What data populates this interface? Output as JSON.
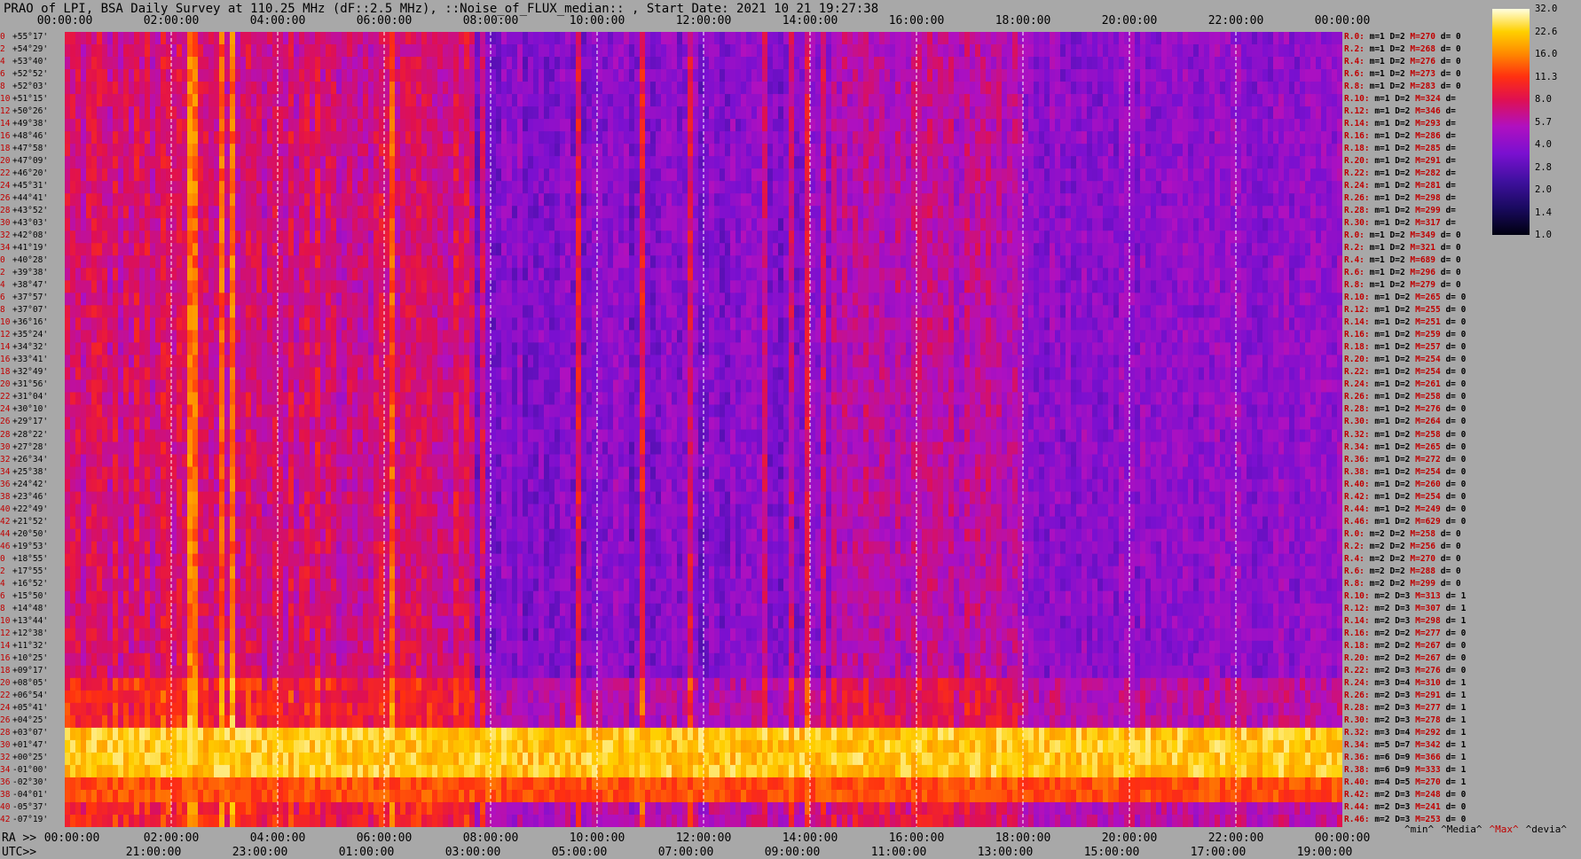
{
  "title": "PRAO of LPI, BSA Daily Survey at 110.25 MHz (dF::2.5 MHz), ::Noise_of_FLUX_median:: , Start Date: 2021 10 21 19:27:38",
  "top_times": [
    "00:00:00",
    "02:00:00",
    "04:00:00",
    "06:00:00",
    "08:00:00",
    "10:00:00",
    "12:00:00",
    "14:00:00",
    "16:00:00",
    "18:00:00",
    "20:00:00",
    "22:00:00",
    "00:00:00"
  ],
  "ra_prefix": "RA >>",
  "ra_times": [
    "00:00:00",
    "02:00:00",
    "04:00:00",
    "06:00:00",
    "08:00:00",
    "10:00:00",
    "12:00:00",
    "14:00:00",
    "16:00:00",
    "18:00:00",
    "20:00:00",
    "22:00:00",
    "00:00:00"
  ],
  "utc_prefix": "UTC>>",
  "utc_times": [
    "21:00:00",
    "23:00:00",
    "01:00:00",
    "03:00:00",
    "05:00:00",
    "07:00:00",
    "09:00:00",
    "11:00:00",
    "13:00:00",
    "15:00:00",
    "17:00:00",
    "19:00:00"
  ],
  "colorbar": {
    "ticks": [
      "32.0",
      "22.6",
      "16.0",
      "11.3",
      "8.0",
      "5.7",
      "4.0",
      "2.8",
      "2.0",
      "1.4",
      "1.0"
    ]
  },
  "footer": {
    "min": "^min^",
    "median": "^Media^",
    "max": "^Max^",
    "devia": "^devia^"
  },
  "colors": {
    "background": "#a8a8a8",
    "label_red": "#c00000"
  },
  "chart_data": {
    "type": "heatmap",
    "title": "PRAO of LPI, BSA Daily Survey at 110.25 MHz (dF::2.5 MHz), ::Noise_of_FLUX_median:: , Start Date: 2021 10 21 19:27:38",
    "x_axis": "sidereal time RA 00:00:00 to 24:00:00, grid every 2h",
    "color_scale": "log, 1.0 to 32.0",
    "declinations": [
      "+55°17'",
      "+54°29'",
      "+53°40'",
      "+52°52'",
      "+52°03'",
      "+51°15'",
      "+50°26'",
      "+49°38'",
      "+48°46'",
      "+47°58'",
      "+47°09'",
      "+46°20'",
      "+45°31'",
      "+44°41'",
      "+43°52'",
      "+43°03'",
      "+42°08'",
      "+41°19'",
      "+40°28'",
      "+39°38'",
      "+38°47'",
      "+37°57'",
      "+37°07'",
      "+36°16'",
      "+35°24'",
      "+34°32'",
      "+33°41'",
      "+32°49'",
      "+31°56'",
      "+31°04'",
      "+30°10'",
      "+29°17'",
      "+28°22'",
      "+27°28'",
      "+26°34'",
      "+25°38'",
      "+24°42'",
      "+23°46'",
      "+22°49'",
      "+21°52'",
      "+20°50'",
      "+19°53'",
      "+18°55'",
      "+17°55'",
      "+16°52'",
      "+15°50'",
      "+14°48'",
      "+13°44'",
      "+12°38'",
      "+11°32'",
      "+10°25'",
      "+09°17'",
      "+08°05'",
      "+06°54'",
      "+05°41'",
      "+04°25'",
      "+03°07'",
      "+01°47'",
      "+00°25'",
      "-01°00'",
      "-02°30'",
      "-04°01'",
      "-05°37'",
      "-07°19'"
    ],
    "row_index_labels": [
      "0",
      "2",
      "4",
      "6",
      "8",
      "10",
      "12",
      "14",
      "16",
      "18",
      "20",
      "22",
      "24",
      "26",
      "28",
      "30",
      "32",
      "34",
      "0",
      "2",
      "4",
      "6",
      "8",
      "10",
      "12",
      "14",
      "16",
      "18",
      "20",
      "22",
      "24",
      "26",
      "28",
      "30",
      "32",
      "34",
      "36",
      "38",
      "40",
      "42",
      "44",
      "46",
      "0",
      "2",
      "4",
      "6",
      "8",
      "10",
      "12",
      "14",
      "16",
      "18",
      "20",
      "22",
      "24",
      "26",
      "28",
      "30",
      "32",
      "34",
      "36",
      "38",
      "40",
      "42"
    ],
    "receivers": [
      {
        "r": "R.0:",
        "m": "m=1",
        "D": "D=2",
        "M": "M=270",
        "d": "d= 0"
      },
      {
        "r": "R.2:",
        "m": "m=1",
        "D": "D=2",
        "M": "M=268",
        "d": "d= 0"
      },
      {
        "r": "R.4:",
        "m": "m=1",
        "D": "D=2",
        "M": "M=276",
        "d": "d= 0"
      },
      {
        "r": "R.6:",
        "m": "m=1",
        "D": "D=2",
        "M": "M=273",
        "d": "d= 0"
      },
      {
        "r": "R.8:",
        "m": "m=1",
        "D": "D=2",
        "M": "M=283",
        "d": "d= 0"
      },
      {
        "r": "R.10:",
        "m": "m=1",
        "D": "D=2",
        "M": "M=324",
        "d": "d="
      },
      {
        "r": "R.12:",
        "m": "m=1",
        "D": "D=2",
        "M": "M=346",
        "d": "d="
      },
      {
        "r": "R.14:",
        "m": "m=1",
        "D": "D=2",
        "M": "M=293",
        "d": "d="
      },
      {
        "r": "R.16:",
        "m": "m=1",
        "D": "D=2",
        "M": "M=286",
        "d": "d="
      },
      {
        "r": "R.18:",
        "m": "m=1",
        "D": "D=2",
        "M": "M=285",
        "d": "d="
      },
      {
        "r": "R.20:",
        "m": "m=1",
        "D": "D=2",
        "M": "M=291",
        "d": "d="
      },
      {
        "r": "R.22:",
        "m": "m=1",
        "D": "D=2",
        "M": "M=282",
        "d": "d="
      },
      {
        "r": "R.24:",
        "m": "m=1",
        "D": "D=2",
        "M": "M=281",
        "d": "d="
      },
      {
        "r": "R.26:",
        "m": "m=1",
        "D": "D=2",
        "M": "M=298",
        "d": "d="
      },
      {
        "r": "R.28:",
        "m": "m=1",
        "D": "D=2",
        "M": "M=299",
        "d": "d="
      },
      {
        "r": "R.30:",
        "m": "m=1",
        "D": "D=2",
        "M": "M=317",
        "d": "d="
      },
      {
        "r": "R.0:",
        "m": "m=1",
        "D": "D=2",
        "M": "M=349",
        "d": "d= 0"
      },
      {
        "r": "R.2:",
        "m": "m=1",
        "D": "D=2",
        "M": "M=321",
        "d": "d= 0"
      },
      {
        "r": "R.4:",
        "m": "m=1",
        "D": "D=2",
        "M": "M=689",
        "d": "d= 0"
      },
      {
        "r": "R.6:",
        "m": "m=1",
        "D": "D=2",
        "M": "M=296",
        "d": "d= 0"
      },
      {
        "r": "R.8:",
        "m": "m=1",
        "D": "D=2",
        "M": "M=279",
        "d": "d= 0"
      },
      {
        "r": "R.10:",
        "m": "m=1",
        "D": "D=2",
        "M": "M=265",
        "d": "d= 0"
      },
      {
        "r": "R.12:",
        "m": "m=1",
        "D": "D=2",
        "M": "M=255",
        "d": "d= 0"
      },
      {
        "r": "R.14:",
        "m": "m=1",
        "D": "D=2",
        "M": "M=251",
        "d": "d= 0"
      },
      {
        "r": "R.16:",
        "m": "m=1",
        "D": "D=2",
        "M": "M=259",
        "d": "d= 0"
      },
      {
        "r": "R.18:",
        "m": "m=1",
        "D": "D=2",
        "M": "M=257",
        "d": "d= 0"
      },
      {
        "r": "R.20:",
        "m": "m=1",
        "D": "D=2",
        "M": "M=254",
        "d": "d= 0"
      },
      {
        "r": "R.22:",
        "m": "m=1",
        "D": "D=2",
        "M": "M=254",
        "d": "d= 0"
      },
      {
        "r": "R.24:",
        "m": "m=1",
        "D": "D=2",
        "M": "M=261",
        "d": "d= 0"
      },
      {
        "r": "R.26:",
        "m": "m=1",
        "D": "D=2",
        "M": "M=258",
        "d": "d= 0"
      },
      {
        "r": "R.28:",
        "m": "m=1",
        "D": "D=2",
        "M": "M=276",
        "d": "d= 0"
      },
      {
        "r": "R.30:",
        "m": "m=1",
        "D": "D=2",
        "M": "M=264",
        "d": "d= 0"
      },
      {
        "r": "R.32:",
        "m": "m=1",
        "D": "D=2",
        "M": "M=258",
        "d": "d= 0"
      },
      {
        "r": "R.34:",
        "m": "m=1",
        "D": "D=2",
        "M": "M=265",
        "d": "d= 0"
      },
      {
        "r": "R.36:",
        "m": "m=1",
        "D": "D=2",
        "M": "M=272",
        "d": "d= 0"
      },
      {
        "r": "R.38:",
        "m": "m=1",
        "D": "D=2",
        "M": "M=254",
        "d": "d= 0"
      },
      {
        "r": "R.40:",
        "m": "m=1",
        "D": "D=2",
        "M": "M=260",
        "d": "d= 0"
      },
      {
        "r": "R.42:",
        "m": "m=1",
        "D": "D=2",
        "M": "M=254",
        "d": "d= 0"
      },
      {
        "r": "R.44:",
        "m": "m=1",
        "D": "D=2",
        "M": "M=249",
        "d": "d= 0"
      },
      {
        "r": "R.46:",
        "m": "m=1",
        "D": "D=2",
        "M": "M=629",
        "d": "d= 0"
      },
      {
        "r": "R.0:",
        "m": "m=2",
        "D": "D=2",
        "M": "M=258",
        "d": "d= 0"
      },
      {
        "r": "R.2:",
        "m": "m=2",
        "D": "D=2",
        "M": "M=256",
        "d": "d= 0"
      },
      {
        "r": "R.4:",
        "m": "m=2",
        "D": "D=2",
        "M": "M=270",
        "d": "d= 0"
      },
      {
        "r": "R.6:",
        "m": "m=2",
        "D": "D=2",
        "M": "M=288",
        "d": "d= 0"
      },
      {
        "r": "R.8:",
        "m": "m=2",
        "D": "D=2",
        "M": "M=299",
        "d": "d= 0"
      },
      {
        "r": "R.10:",
        "m": "m=2",
        "D": "D=3",
        "M": "M=313",
        "d": "d= 1"
      },
      {
        "r": "R.12:",
        "m": "m=2",
        "D": "D=3",
        "M": "M=307",
        "d": "d= 1"
      },
      {
        "r": "R.14:",
        "m": "m=2",
        "D": "D=3",
        "M": "M=298",
        "d": "d= 1"
      },
      {
        "r": "R.16:",
        "m": "m=2",
        "D": "D=2",
        "M": "M=277",
        "d": "d= 0"
      },
      {
        "r": "R.18:",
        "m": "m=2",
        "D": "D=2",
        "M": "M=267",
        "d": "d= 0"
      },
      {
        "r": "R.20:",
        "m": "m=2",
        "D": "D=2",
        "M": "M=267",
        "d": "d= 0"
      },
      {
        "r": "R.22:",
        "m": "m=2",
        "D": "D=3",
        "M": "M=276",
        "d": "d= 0"
      },
      {
        "r": "R.24:",
        "m": "m=3",
        "D": "D=4",
        "M": "M=310",
        "d": "d= 1"
      },
      {
        "r": "R.26:",
        "m": "m=2",
        "D": "D=3",
        "M": "M=291",
        "d": "d= 1"
      },
      {
        "r": "R.28:",
        "m": "m=2",
        "D": "D=3",
        "M": "M=277",
        "d": "d= 1"
      },
      {
        "r": "R.30:",
        "m": "m=2",
        "D": "D=3",
        "M": "M=278",
        "d": "d= 1"
      },
      {
        "r": "R.32:",
        "m": "m=3",
        "D": "D=4",
        "M": "M=292",
        "d": "d= 1"
      },
      {
        "r": "R.34:",
        "m": "m=5",
        "D": "D=7",
        "M": "M=342",
        "d": "d= 1"
      },
      {
        "r": "R.36:",
        "m": "m=6",
        "D": "D=9",
        "M": "M=366",
        "d": "d= 1"
      },
      {
        "r": "R.38:",
        "m": "m=6",
        "D": "D=9",
        "M": "M=333",
        "d": "d= 1"
      },
      {
        "r": "R.40:",
        "m": "m=4",
        "D": "D=5",
        "M": "M=270",
        "d": "d= 1"
      },
      {
        "r": "R.42:",
        "m": "m=2",
        "D": "D=3",
        "M": "M=248",
        "d": "d= 0"
      },
      {
        "r": "R.44:",
        "m": "m=2",
        "D": "D=3",
        "M": "M=241",
        "d": "d= 0"
      },
      {
        "r": "R.46:",
        "m": "m=2",
        "D": "D=3",
        "M": "M=253",
        "d": "d= 0"
      }
    ]
  }
}
